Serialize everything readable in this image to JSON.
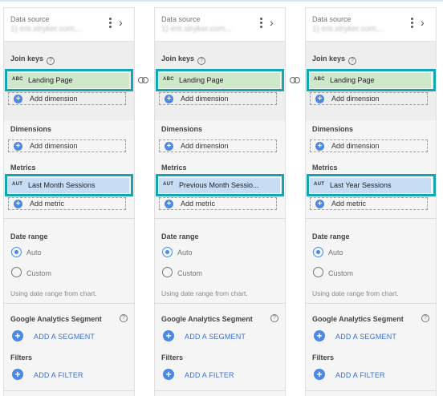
{
  "panels": [
    {
      "data_source_label": "Data source",
      "data_source_value": "1) ent.stryker.com...",
      "join_keys_title": "Join keys",
      "join_key": {
        "tag": "ABC",
        "label": "Landing Page"
      },
      "add_dimension_label": "Add dimension",
      "dimensions_title": "Dimensions",
      "metrics_title": "Metrics",
      "metric": {
        "tag": "AUT",
        "label": "Last Month Sessions"
      },
      "add_metric_label": "Add metric",
      "date_range_title": "Date range",
      "auto_label": "Auto",
      "custom_label": "Custom",
      "date_note": "Using date range from chart.",
      "segment_title": "Google Analytics Segment",
      "add_segment_label": "ADD A SEGMENT",
      "filters_title": "Filters",
      "add_filter_label": "ADD A FILTER"
    },
    {
      "data_source_label": "Data source",
      "data_source_value": "1) ent.stryker.com...",
      "join_keys_title": "Join keys",
      "join_key": {
        "tag": "ABC",
        "label": "Landing Page"
      },
      "add_dimension_label": "Add dimension",
      "dimensions_title": "Dimensions",
      "metrics_title": "Metrics",
      "metric": {
        "tag": "AUT",
        "label": "Previous Month Sessio..."
      },
      "add_metric_label": "Add metric",
      "date_range_title": "Date range",
      "auto_label": "Auto",
      "custom_label": "Custom",
      "date_note": "Using date range from chart.",
      "segment_title": "Google Analytics Segment",
      "add_segment_label": "ADD A SEGMENT",
      "filters_title": "Filters",
      "add_filter_label": "ADD A FILTER"
    },
    {
      "data_source_label": "Data source",
      "data_source_value": "1) ent.stryker.com...",
      "join_keys_title": "Join keys",
      "join_key": {
        "tag": "ABC",
        "label": "Landing Page"
      },
      "add_dimension_label": "Add dimension",
      "dimensions_title": "Dimensions",
      "metrics_title": "Metrics",
      "metric": {
        "tag": "AUT",
        "label": "Last Year Sessions"
      },
      "add_metric_label": "Add metric",
      "date_range_title": "Date range",
      "auto_label": "Auto",
      "custom_label": "Custom",
      "date_note": "Using date range from chart.",
      "segment_title": "Google Analytics Segment",
      "add_segment_label": "ADD A SEGMENT",
      "filters_title": "Filters",
      "add_filter_label": "ADD A FILTER"
    }
  ],
  "icons": {
    "more": "more-vert-icon",
    "chevron": "chevron-right-icon",
    "help": "help-icon",
    "link": "link-icon",
    "add": "add-circle-icon"
  },
  "colors": {
    "highlight": "#14a5b5",
    "dimension_chip": "#cfe8c9",
    "metric_chip": "#c6ddf4",
    "accent": "#4b89e7"
  }
}
